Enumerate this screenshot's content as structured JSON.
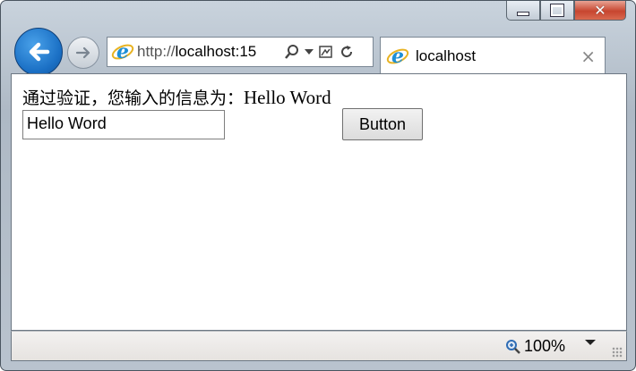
{
  "window": {
    "close_symbol": "✕"
  },
  "address_bar": {
    "url_prefix": "http://",
    "url_host": "localhost:15"
  },
  "tab": {
    "title": "localhost",
    "close_symbol": "×"
  },
  "page": {
    "message_zh": "通过验证，您输入的信息为：",
    "message_value": "Hello Word",
    "input_value": "Hello Word",
    "button_label": "Button"
  },
  "status_bar": {
    "zoom": "100%"
  },
  "icons": {
    "back": "back-arrow-icon",
    "forward": "forward-arrow-icon",
    "ie": "ie-logo-icon",
    "search": "search-icon",
    "dropdown": "chevron-down-icon",
    "compat": "compatibility-view-icon",
    "refresh": "refresh-icon",
    "zoom": "zoom-icon"
  },
  "colors": {
    "back_button": "#1a6fc4",
    "close_button": "#c7452f",
    "ie_logo": "#1e8fd6"
  }
}
